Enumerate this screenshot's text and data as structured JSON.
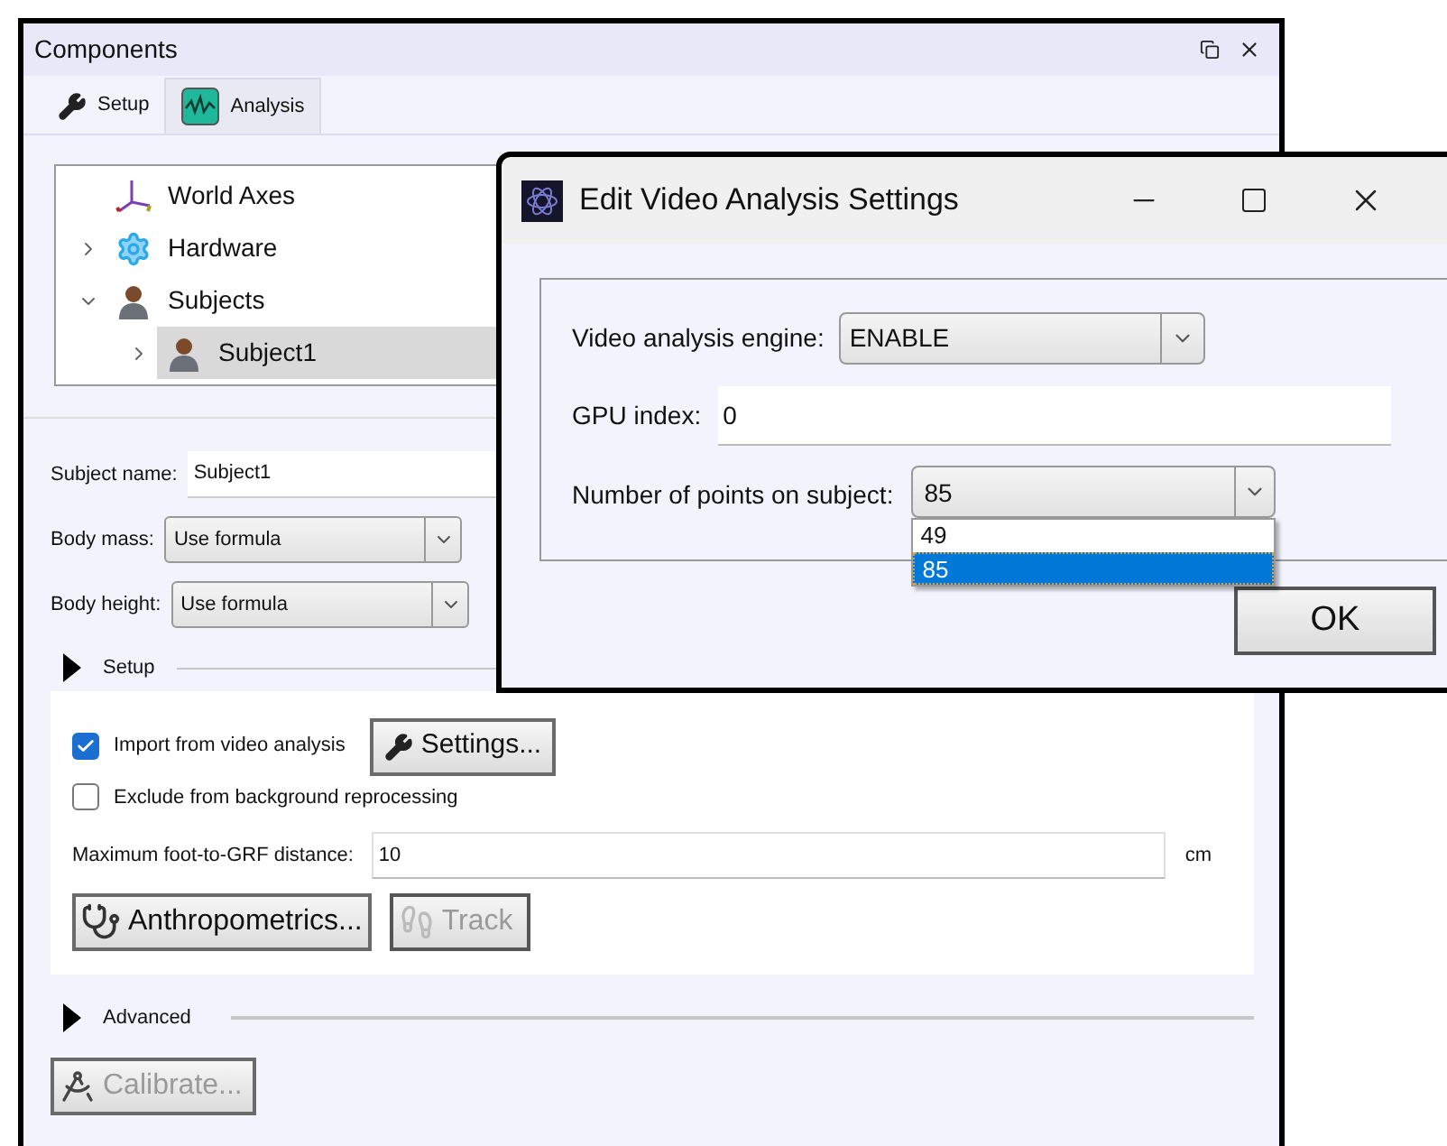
{
  "window": {
    "title": "Components"
  },
  "tabs": [
    {
      "label": "Setup",
      "selected": true,
      "kind": "wrench"
    },
    {
      "label": "Analysis",
      "selected": false,
      "kind": "wave"
    }
  ],
  "tree": [
    {
      "label": "World Axes",
      "kind": "axes",
      "selected": false
    },
    {
      "label": "Hardware",
      "kind": "gear",
      "selected": false,
      "expanded": false
    },
    {
      "label": "Subjects",
      "kind": "person",
      "selected": false,
      "expanded": true,
      "children": [
        {
          "label": "Subject1",
          "kind": "person",
          "selected": true,
          "expanded": false
        }
      ]
    }
  ],
  "subject_form": [
    {
      "label": "Subject name:",
      "value": "Subject1",
      "kind": "text"
    },
    {
      "label": "Body mass:",
      "value": "Use formula",
      "kind": "select"
    },
    {
      "label": "Body height:",
      "value": "Use formula",
      "kind": "select"
    }
  ],
  "setup_section": {
    "title": "Setup",
    "import_checkbox": {
      "label": "Import from video analysis",
      "checked": true
    },
    "settings_button": "Settings...",
    "exclude_checkbox": {
      "label": "Exclude from background reprocessing",
      "checked": false
    },
    "max_distance": {
      "label": "Maximum foot-to-GRF distance:",
      "value": "10",
      "unit": "cm"
    },
    "anthropometrics_button": {
      "label": "Anthropometrics...",
      "disabled": false
    },
    "track_button": {
      "label": "Track",
      "disabled": true
    }
  },
  "advanced_section": {
    "title": "Advanced"
  },
  "calibrate_button": {
    "label": "Calibrate...",
    "disabled": true
  },
  "dialog": {
    "title": "Edit Video Analysis Settings",
    "engine": {
      "label": "Video analysis engine:",
      "value": "ENABLE"
    },
    "gpu_index": {
      "label": "GPU index:",
      "value": "0"
    },
    "points": {
      "label": "Number of points on subject:",
      "value": "85",
      "expanded": true,
      "options": [
        {
          "label": "49",
          "selected": false
        },
        {
          "label": "85",
          "selected": true
        }
      ]
    },
    "ok_button": "OK"
  }
}
